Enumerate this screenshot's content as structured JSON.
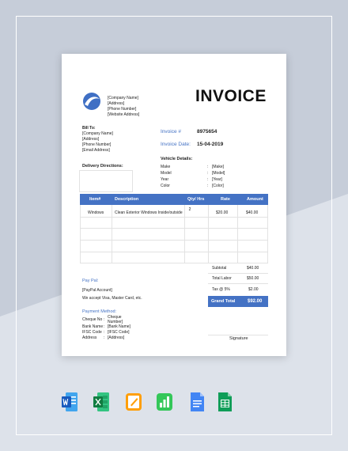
{
  "company": {
    "name": "[Company Name]",
    "address": "[Address]",
    "phone": "[Phone Number]",
    "website": "[Website Address]"
  },
  "title": "INVOICE",
  "bill_to": {
    "label": "Bill To:",
    "company": "[Company Name]",
    "address": "[Address]",
    "phone": "[Phone Number]",
    "email": "[Email Address]"
  },
  "invoice": {
    "number_label": "Invoice #",
    "number": "8975654",
    "date_label": "Invoice Date:",
    "date": "15-04-2019"
  },
  "delivery_label": "Delivery Directions:",
  "vehicle": {
    "label": "Vehicle Details:",
    "rows": [
      {
        "key": "Make",
        "sep": ":",
        "value": "[Make]"
      },
      {
        "key": "Model",
        "sep": ":",
        "value": "[Model]"
      },
      {
        "key": "Year",
        "sep": ":",
        "value": "[Year]"
      },
      {
        "key": "Color",
        "sep": ":",
        "value": "[Color]"
      }
    ]
  },
  "table": {
    "headers": [
      "Item#",
      "Description",
      "Qty/ Hrs",
      "Rate",
      "Amount"
    ],
    "rows": [
      {
        "item": "Windows",
        "description": "Clean Exterior Windows Inside/outside",
        "qty": "2",
        "rate": "$20.00",
        "amount": "$40.00"
      }
    ]
  },
  "totals": {
    "subtotal_label": "Subtotal",
    "subtotal": "$40.00",
    "labor_label": "Total Labor",
    "labor": "$50.00",
    "tax_label": "Tax @ 5%",
    "tax": "$2.00",
    "grand_label": "Grand Total",
    "grand": "$92.00"
  },
  "paypal": {
    "label": "Pay Pal:",
    "account": "[PayPal Account]",
    "accept": "We accept Visa, Master Card, etc."
  },
  "payment": {
    "label": "Payment Method:",
    "rows": [
      {
        "key": "Cheque No",
        "sep": ":",
        "value": "Cheque",
        "value2": "Number]"
      },
      {
        "key": "Bank Name",
        "sep": ":",
        "value": "[Bank Name]"
      },
      {
        "key": "IFSC Code",
        "sep": ":",
        "value": "[IFSC Code]"
      },
      {
        "key": "Address",
        "sep": ":",
        "value": "[Address]"
      }
    ]
  },
  "signature_label": "Signature",
  "app_icons": [
    "word-icon",
    "excel-icon",
    "pages-icon",
    "numbers-icon",
    "google-docs-icon",
    "google-sheets-icon"
  ],
  "colors": {
    "accent": "#4472c4",
    "background": "#dde2ea",
    "shade": "#c3cad6"
  }
}
